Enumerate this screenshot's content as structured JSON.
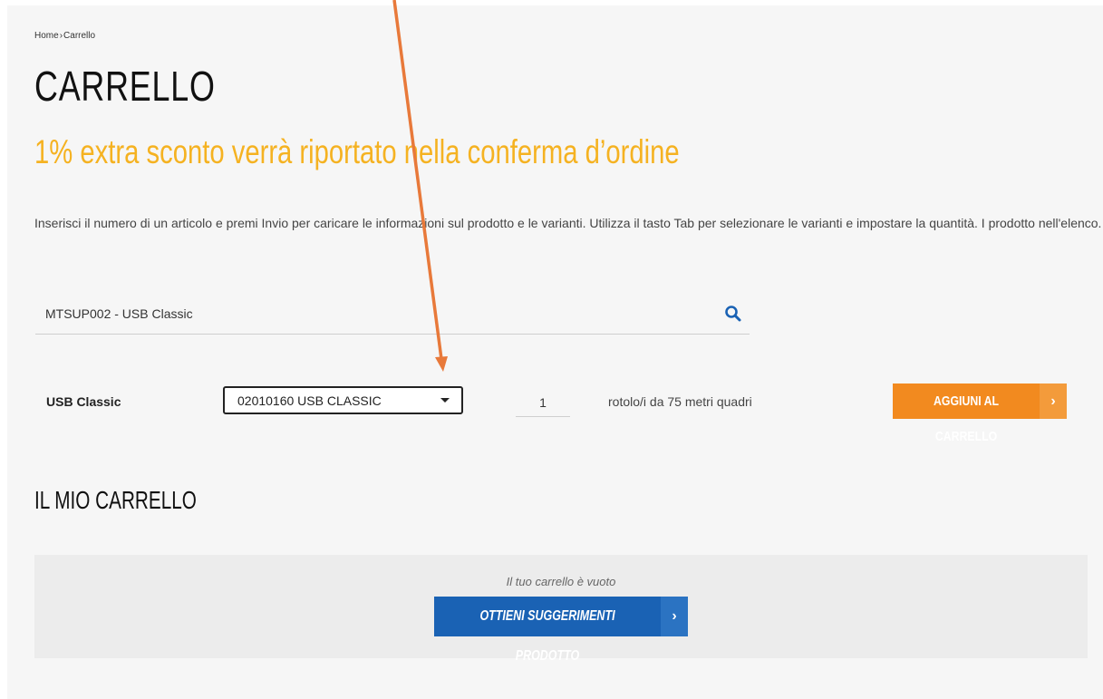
{
  "breadcrumb": {
    "home": "Home",
    "separator": "›",
    "current": "Carrello"
  },
  "title": "CARRELLO",
  "promo_text": "1% extra sconto verrà riportato nella conferma d’ordine",
  "instructions": "Inserisci il numero di un articolo e premi Invio per caricare le informazioni sul prodotto e le varianti. Utilizza il tasto Tab per selezionare le varianti e impostare la quantità. I prodotto nell'elenco.",
  "search": {
    "value": "MTSUP002 - USB Classic",
    "icon": "search-icon"
  },
  "product_row": {
    "name": "USB Classic",
    "variant": "02010160 USB CLASSIC",
    "quantity": "1",
    "unit": "rotolo/i da 75 metri quadri",
    "add_button": "AGGIUNI AL CARRELLO",
    "add_button_chevron": "›"
  },
  "cart": {
    "title": "IL MIO CARRELLO",
    "empty_message": "Il tuo carrello è vuoto",
    "suggest_button": "OTTIENI SUGGERIMENTI PRODOTTO",
    "suggest_button_chevron": "›"
  },
  "colors": {
    "promo": "#f5b221",
    "add_button": "#f28a1f",
    "suggest_button": "#1a62b4",
    "annotation_arrow": "#e8793a"
  }
}
